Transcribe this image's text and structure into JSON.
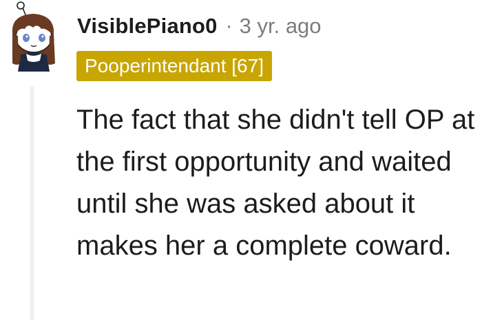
{
  "comment": {
    "author": "VisiblePiano0",
    "separator": "·",
    "timestamp": "3 yr. ago",
    "flair": "Pooperintendant [67]",
    "body": "The fact that she didn't tell OP at the first opportunity and waited until she was asked about it makes her a complete coward."
  },
  "avatar": {
    "icon": "snoo-avatar-icon",
    "hair_color": "#6b3a22",
    "eye_color": "#6a86c7",
    "shirt_color": "#1e2a44"
  },
  "colors": {
    "flair_background": "#c8a500",
    "flair_text": "#ffffff",
    "meta_text": "#7c7c7c",
    "thread_line": "#edeff1"
  }
}
